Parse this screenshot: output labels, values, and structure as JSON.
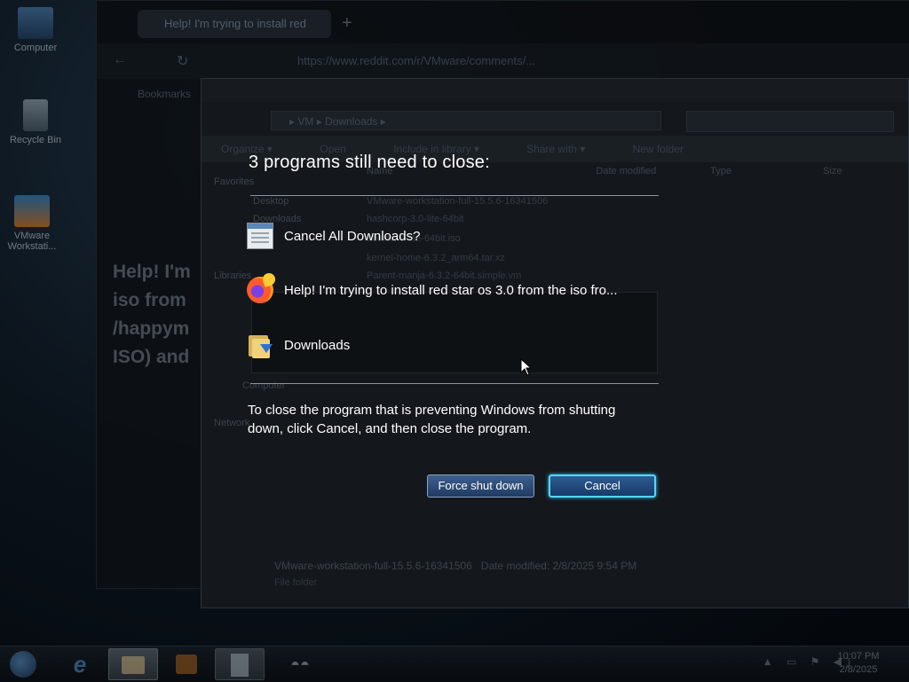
{
  "desktop": {
    "icons": [
      {
        "label": "Computer"
      },
      {
        "label": "Recycle Bin"
      },
      {
        "label": "VMware Workstati..."
      }
    ]
  },
  "background_browser": {
    "tab_title": "Help! I'm trying to install red",
    "url": "https://www.reddit.com/r/VMware/comments/...",
    "post_title_fragment": "Help! I'm\niso from\n/happym\nISO) and",
    "bookmark_text": "Bookmarks"
  },
  "background_explorer": {
    "breadcrumb": "▸ VM ▸ Downloads ▸",
    "toolbar": [
      "Organize ▾",
      "Open",
      "Include in library ▾",
      "Share with ▾",
      "New folder"
    ],
    "columns": [
      "Name",
      "Date modified",
      "Type",
      "Size"
    ],
    "sidebar": [
      "Favorites",
      "Desktop",
      "Downloads",
      "Libraries",
      "Computer",
      "Network"
    ],
    "rows": [
      "VMware-workstation-full-15.5.6-16341506",
      "hashcorp-3.0-lite-64bit",
      "ubuntu-9-lite-64bit.iso",
      "kernel-home-6.3.2_arm64.tar.xz",
      "Parent-manja-6.3.2-64bit.simple.vm"
    ],
    "status_name": "VMware-workstation-full-15.5.6-16341506",
    "status_meta": "Date modified: 2/8/2025 9:54 PM",
    "status_type": "File folder"
  },
  "shutdown_dialog": {
    "heading": "3 programs still need to close:",
    "programs": [
      {
        "label": "Cancel All Downloads?",
        "icon": "downloads-window-icon"
      },
      {
        "label": "Help! I'm trying to install red star os 3.0 from the iso fro...",
        "icon": "firefox-icon"
      },
      {
        "label": "Downloads",
        "icon": "folder-downloads-icon"
      }
    ],
    "message": "To close the program that is preventing Windows from shutting down, click Cancel, and then close the program.",
    "force_label": "Force shut down",
    "cancel_label": "Cancel",
    "colors": {
      "cancel_focus": "#56d6ff",
      "button_bg": "#203a62"
    }
  },
  "taskbar": {
    "clock_time": "10:07 PM",
    "clock_date": "2/8/2025"
  }
}
